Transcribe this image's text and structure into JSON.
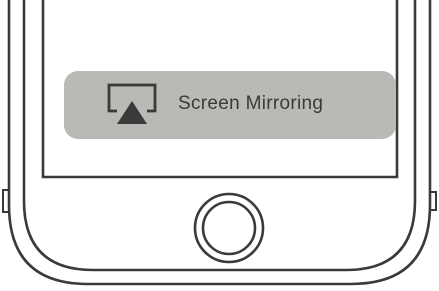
{
  "screen_mirroring": {
    "label": "Screen Mirroring",
    "icon": "airplay-icon"
  },
  "home_button": {
    "icon": "home-button-icon"
  },
  "colors": {
    "outline": "#3a3a3a",
    "button_fill": "#b9bab6",
    "background": "#ffffff"
  }
}
